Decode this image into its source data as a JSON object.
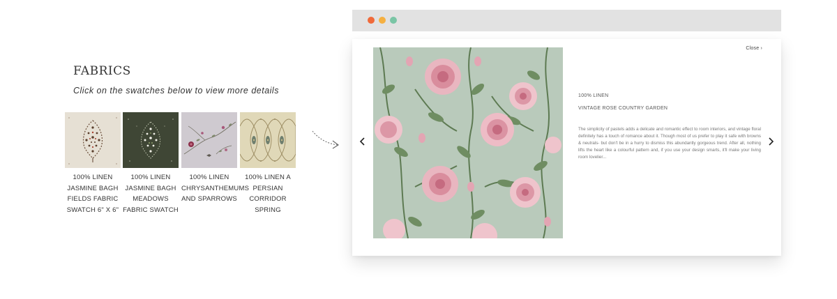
{
  "fabrics": {
    "title": "FABRICS",
    "subtitle": "Click on the swatches below to view more details",
    "swatches": [
      {
        "label": "100% LINEN JASMINE BAGH FIELDS FABRIC SWATCH 6\" X 6\""
      },
      {
        "label": "100% LINEN JASMINE BAGH MEADOWS FABRIC SWATCH"
      },
      {
        "label": "100% LINEN CHRYSANTHEMUMS AND SPARROWS"
      },
      {
        "label": "100% LINEN A PERSIAN CORRIDOR SPRING"
      }
    ]
  },
  "modal": {
    "close_label": "Close",
    "material": "100% LINEN",
    "product_name": "VINTAGE ROSE COUNTRY GARDEN",
    "description": "The simplicity of pastels adds a delicate and romantic effect to room interiors, and vintage floral definitely has a touch of romance about it. Though most of us prefer to play it safe with browns & neutrals- but don't be in a hurry to dismiss this abundantly gorgeous trend. After all, nothing lifts the heart like a colourful pattern and, if you use your design smarts, it'll make your living room lovelier..."
  },
  "colors": {
    "dot_red": "#f06a3a",
    "dot_yellow": "#f5b041",
    "dot_green": "#7ac5a5",
    "rose_background": "#b9cabb"
  },
  "icons": {
    "prev": "chevron-left-icon",
    "next": "chevron-right-icon",
    "close": "chevron-right-icon",
    "arrow": "dotted-curved-arrow-icon"
  }
}
